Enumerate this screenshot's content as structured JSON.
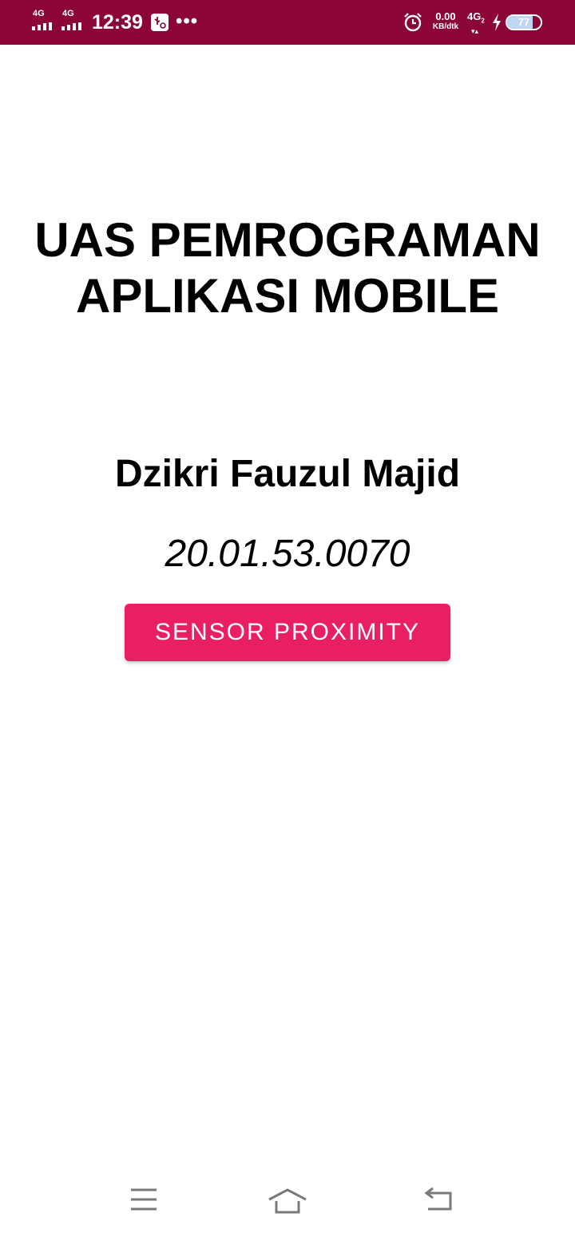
{
  "status_bar": {
    "sim1_network": "4G",
    "sim2_network": "4G",
    "time": "12:39",
    "data_speed_value": "0.00",
    "data_speed_unit": "KB/dtk",
    "mobile_network": "4G",
    "network_sub": "2",
    "battery_level": "77",
    "battery_fraction": 0.77,
    "icons": [
      "signal-icon",
      "usb-debug-icon",
      "more-notifications-icon",
      "alarm-icon",
      "data-arrows-icon",
      "charging-bolt-icon",
      "battery-icon"
    ],
    "background_color": "#8b0537"
  },
  "main": {
    "title_line1": "UAS PEMROGRAMAN",
    "title_line2": "APLIKASI MOBILE",
    "student_name": "Dzikri Fauzul Majid",
    "student_id": "20.01.53.0070",
    "button_label": "SENSOR PROXIMITY",
    "button_color": "#e91e63"
  },
  "nav_bar": {
    "icons": [
      "menu-icon",
      "home-icon",
      "back-icon"
    ]
  }
}
